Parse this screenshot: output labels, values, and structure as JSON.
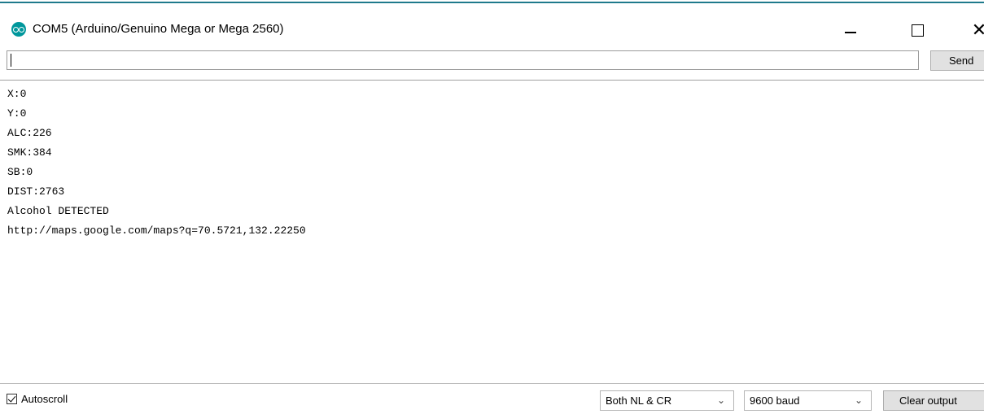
{
  "window": {
    "title": "COM5 (Arduino/Genuino Mega or Mega 2560)",
    "minimize_icon": "minimize-icon",
    "maximize_icon": "maximize-icon",
    "close_glyph": "✕"
  },
  "send": {
    "input_value": "",
    "button_label": "Send"
  },
  "output": {
    "lines": [
      "X:0",
      "Y:0",
      "ALC:226",
      "SMK:384",
      "SB:0",
      "DIST:2763",
      "Alcohol DETECTED",
      "http://maps.google.com/maps?q=70.5721,132.22250"
    ]
  },
  "footer": {
    "autoscroll_label": "Autoscroll",
    "autoscroll_checked": true,
    "line_ending": "Both NL & CR",
    "baud_rate": "9600 baud",
    "clear_label": "Clear output",
    "chevron_glyph": "⌄"
  },
  "colors": {
    "accent_line": "#1f7a8c",
    "arduino_icon": "#00979c",
    "button_bg": "#e1e1e1"
  }
}
